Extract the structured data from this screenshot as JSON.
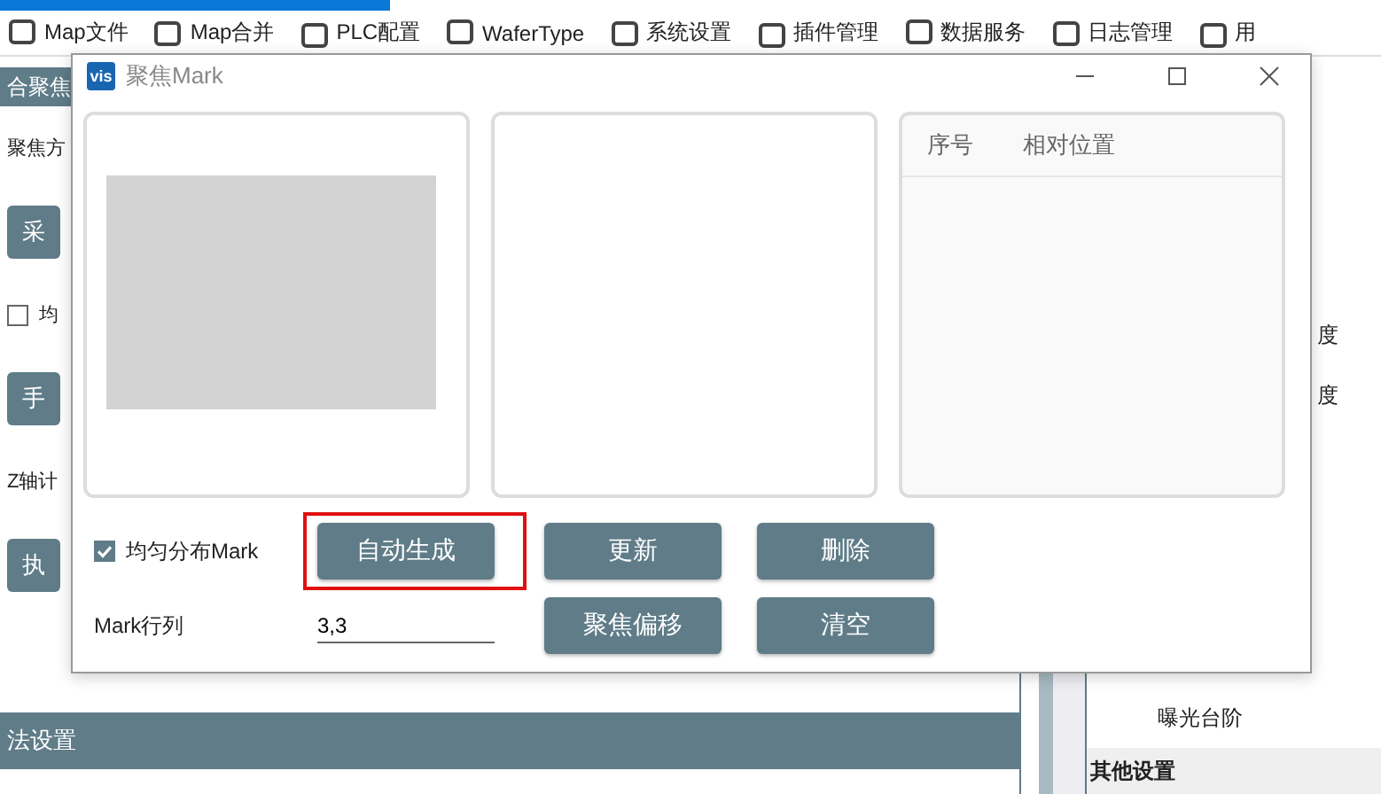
{
  "toolbar": {
    "items": [
      {
        "label": "Map文件"
      },
      {
        "label": "Map合并"
      },
      {
        "label": "PLC配置"
      },
      {
        "label": "WaferType"
      },
      {
        "label": "系统设置"
      },
      {
        "label": "插件管理"
      },
      {
        "label": "数据服务"
      },
      {
        "label": "日志管理"
      },
      {
        "label": "用"
      }
    ]
  },
  "left_panel": {
    "header": "合聚焦",
    "items": [
      {
        "kind": "label",
        "text": "聚焦方"
      },
      {
        "kind": "button",
        "text": "采"
      },
      {
        "kind": "checkbox",
        "text": "均",
        "checked": false
      },
      {
        "kind": "button",
        "text": "手"
      },
      {
        "kind": "label",
        "text": "Z轴计"
      },
      {
        "kind": "button",
        "text": "执"
      }
    ],
    "section": "法设置"
  },
  "right_panel": {
    "items": [
      {
        "kind": "cut",
        "text": "度"
      },
      {
        "kind": "cut",
        "text": "度"
      },
      {
        "kind": "text",
        "text": "曝光台阶"
      },
      {
        "kind": "section",
        "text": "其他设置"
      }
    ]
  },
  "dialog": {
    "logo": "vis",
    "title": "聚焦Mark",
    "table": {
      "columns": [
        "序号",
        "相对位置"
      ]
    },
    "distribute": {
      "label": "均匀分布Mark",
      "checked": true
    },
    "auto_button": {
      "label": "自动生成",
      "highlighted": true
    },
    "grid_field": {
      "label": "Mark行列",
      "value": "3,3"
    },
    "buttons": [
      {
        "label": "更新"
      },
      {
        "label": "删除"
      },
      {
        "label": "聚焦偏移"
      },
      {
        "label": "清空"
      }
    ]
  }
}
